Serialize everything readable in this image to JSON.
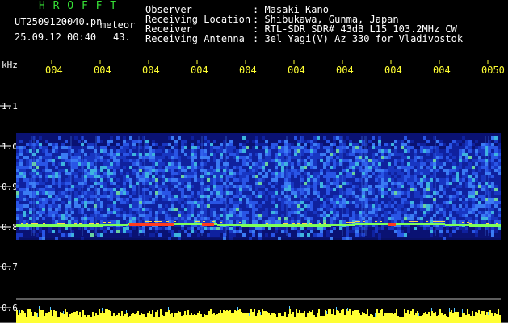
{
  "header": {
    "title": "H R O F F T",
    "filename": "UT2509120040.pn",
    "type": "meteor",
    "datetime": "25.09.12 00:40",
    "count": "43.",
    "fields": [
      {
        "label": "Observer",
        "value": ": Masaki Kano"
      },
      {
        "label": "Receiving Location",
        "value": ": Shibukawa, Gunma, Japan"
      },
      {
        "label": "Receiver",
        "value": ": RTL-SDR SDR# 43dB L15 103.2MHz CW"
      },
      {
        "label": "Receiving Antenna",
        "value": ": 3el Yagi(V) Az 330 for Vladivostok"
      }
    ]
  },
  "y_axis": {
    "unit": "kHz",
    "ticks": [
      "1.1",
      "1.0",
      "0.9",
      "0.8",
      "0.7",
      "0.6"
    ]
  },
  "x_axis": {
    "ticks": [
      "004",
      "004",
      "004",
      "004",
      "004",
      "004",
      "004",
      "004",
      "004",
      "0050"
    ]
  },
  "colors": {
    "background": "#000000",
    "spectrum_base": "#1a2aa0",
    "spectrum_noise": "#2f5cff",
    "carrier_line": "#7dff5a",
    "carrier_hot": "#ff3b1f",
    "signal_bar": "#ffff33",
    "grid": "#ffffff",
    "title_green": "#36e036"
  }
}
